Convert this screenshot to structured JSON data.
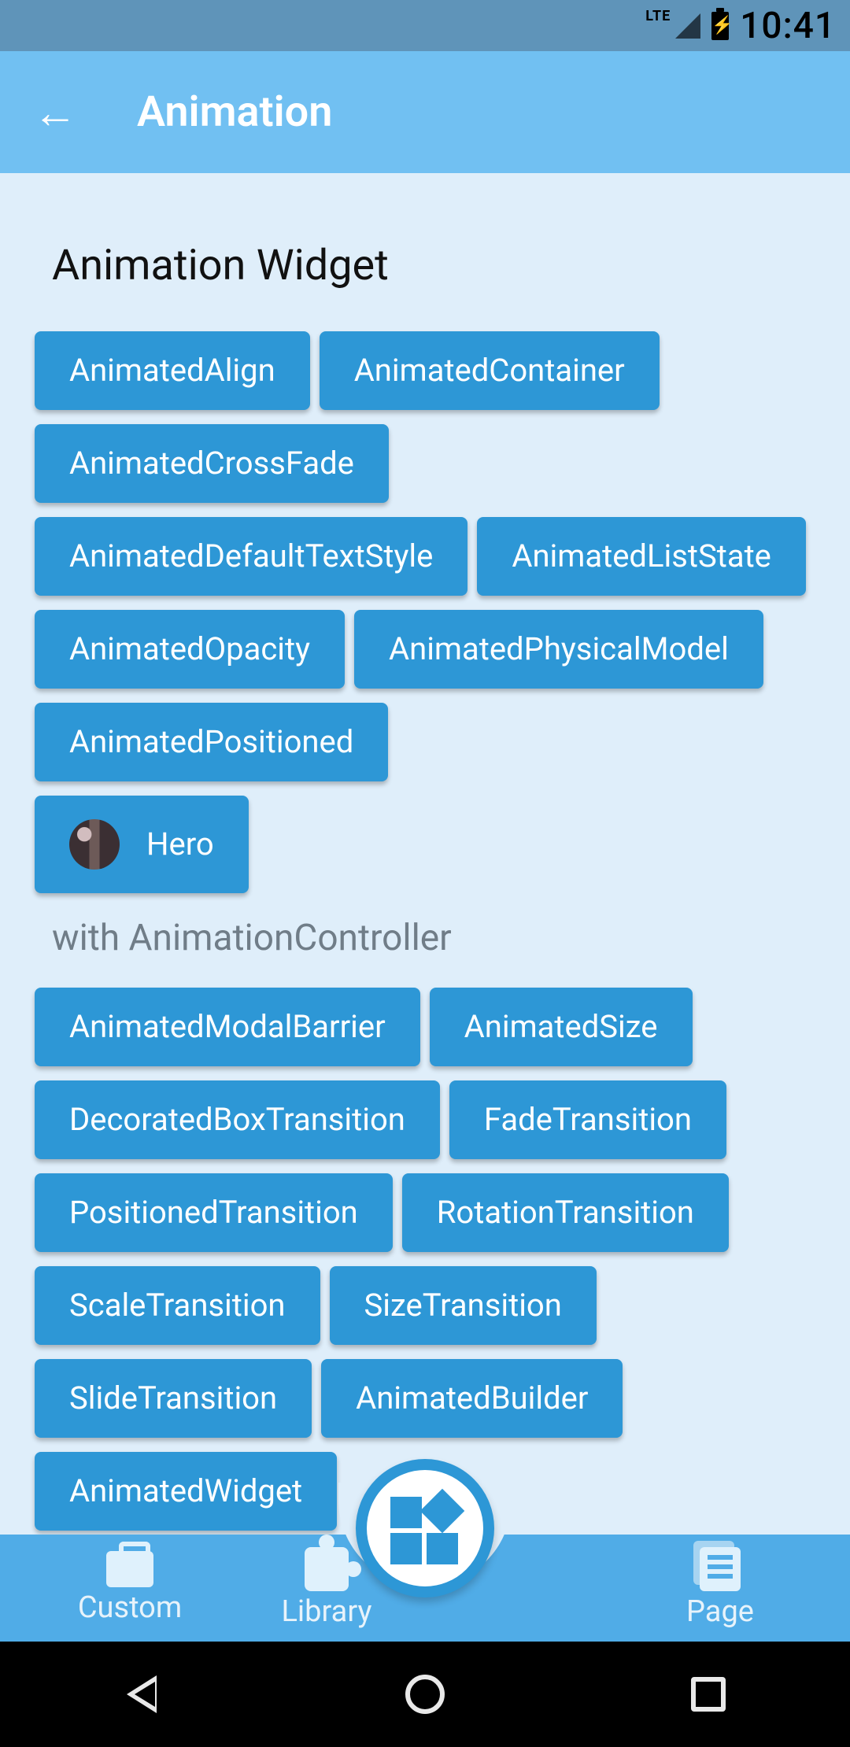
{
  "status": {
    "network_label": "LTE",
    "time": "10:41"
  },
  "appbar": {
    "title": "Animation"
  },
  "page": {
    "section_title": "Animation Widget",
    "subsection_title": "with AnimationController",
    "group1": [
      "AnimatedAlign",
      "AnimatedContainer",
      "AnimatedCrossFade",
      "AnimatedDefaultTextStyle",
      "AnimatedListState",
      "AnimatedOpacity",
      "AnimatedPhysicalModel",
      "AnimatedPositioned"
    ],
    "hero_label": "Hero",
    "group2": [
      "AnimatedModalBarrier",
      "AnimatedSize",
      "DecoratedBoxTransition",
      "FadeTransition",
      "PositionedTransition",
      "RotationTransition",
      "ScaleTransition",
      "SizeTransition",
      "SlideTransition",
      "AnimatedBuilder",
      "AnimatedWidget"
    ]
  },
  "bottom_nav": {
    "custom": "Custom",
    "library": "Library",
    "page": "Page"
  }
}
